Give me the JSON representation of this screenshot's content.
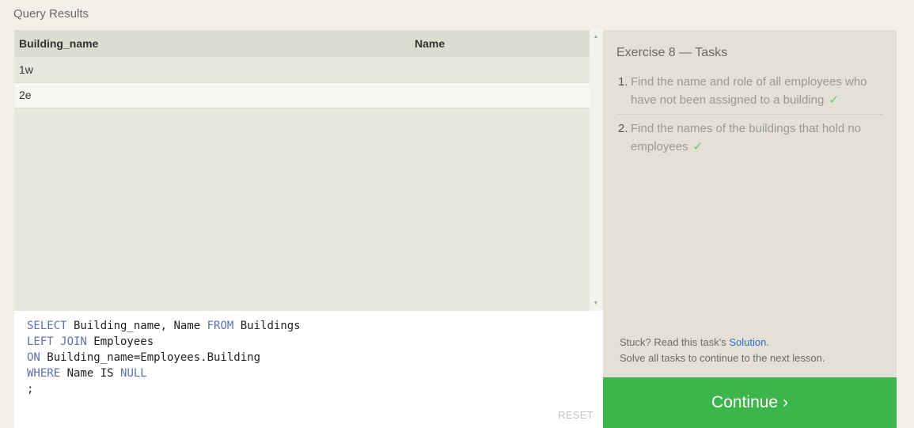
{
  "results": {
    "section_title": "Query Results",
    "columns": [
      "Building_name",
      "Name"
    ],
    "rows": [
      [
        "1w",
        ""
      ],
      [
        "2e",
        ""
      ]
    ]
  },
  "editor": {
    "lines": [
      [
        {
          "t": "SELECT",
          "kw": true
        },
        {
          "t": " Building_name, Name ",
          "kw": false
        },
        {
          "t": "FROM",
          "kw": true
        },
        {
          "t": " Buildings",
          "kw": false
        }
      ],
      [
        {
          "t": "LEFT JOIN",
          "kw": true
        },
        {
          "t": " Employees",
          "kw": false
        }
      ],
      [
        {
          "t": "ON",
          "kw": true
        },
        {
          "t": " Building_name=Employees.Building",
          "kw": false
        }
      ],
      [
        {
          "t": "WHERE",
          "kw": true
        },
        {
          "t": " Name IS ",
          "kw": false
        },
        {
          "t": "NULL",
          "kw": true
        }
      ],
      [
        {
          "t": ";",
          "kw": false
        }
      ]
    ],
    "reset_label": "RESET"
  },
  "tasks": {
    "title": "Exercise 8 — Tasks",
    "items": [
      {
        "num": "1.",
        "text": "Find the name and role of all employees who have not been assigned to a building",
        "done": true
      },
      {
        "num": "2.",
        "text": "Find the names of the buildings that hold no employees",
        "done": true
      }
    ],
    "check_glyph": "✓",
    "help_prefix": "Stuck? Read this task's ",
    "help_link": "Solution",
    "help_suffix": ".",
    "help_line2": "Solve all tasks to continue to the next lesson."
  },
  "continue_label": "Continue ›",
  "colors": {
    "accent_green": "#3cb54b",
    "keyword_blue": "#5c6fb0",
    "link_blue": "#2f6fc8",
    "check_green": "#6cc47a"
  }
}
